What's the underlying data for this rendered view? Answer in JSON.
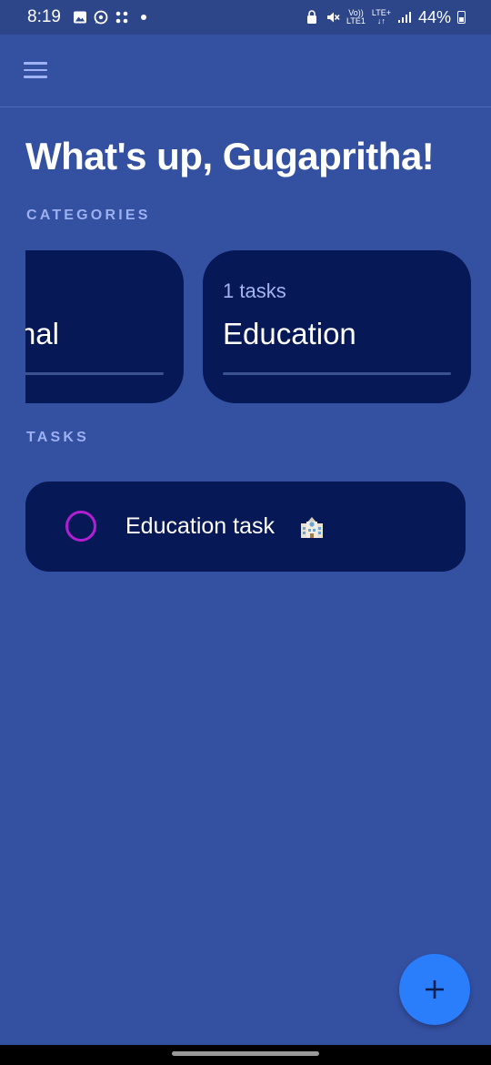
{
  "status_bar": {
    "time": "8:19",
    "network": "LTE+",
    "sim": "LTE1",
    "volte": "Vo))",
    "battery": "44%",
    "left_icons": [
      "gallery-icon",
      "whatsapp-icon",
      "app-grid-icon",
      "notification-dot-icon"
    ],
    "right_icons": [
      "vpn-icon",
      "mute-icon",
      "signal-icon",
      "battery-icon"
    ]
  },
  "header": {
    "menu_icon": "hamburger-menu-icon"
  },
  "greeting": "What's up, Gugapritha!",
  "sections": {
    "categories": "CATEGORIES",
    "tasks": "TASKS"
  },
  "categories": [
    {
      "name": "Personal",
      "visible_name": "nal",
      "count_label": ""
    },
    {
      "name": "Education",
      "visible_name": "Education",
      "count_label": "1 tasks"
    }
  ],
  "tasks": [
    {
      "title": "Education task",
      "icon": "school-building-icon",
      "completed": false
    }
  ],
  "fab": {
    "icon": "plus-icon"
  },
  "colors": {
    "background": "#3450a1",
    "status_bar": "#2d4689",
    "card": "#061856",
    "accent_label": "#9db0f0",
    "task_check": "#b21fd3",
    "fab": "#2a7dfb"
  }
}
